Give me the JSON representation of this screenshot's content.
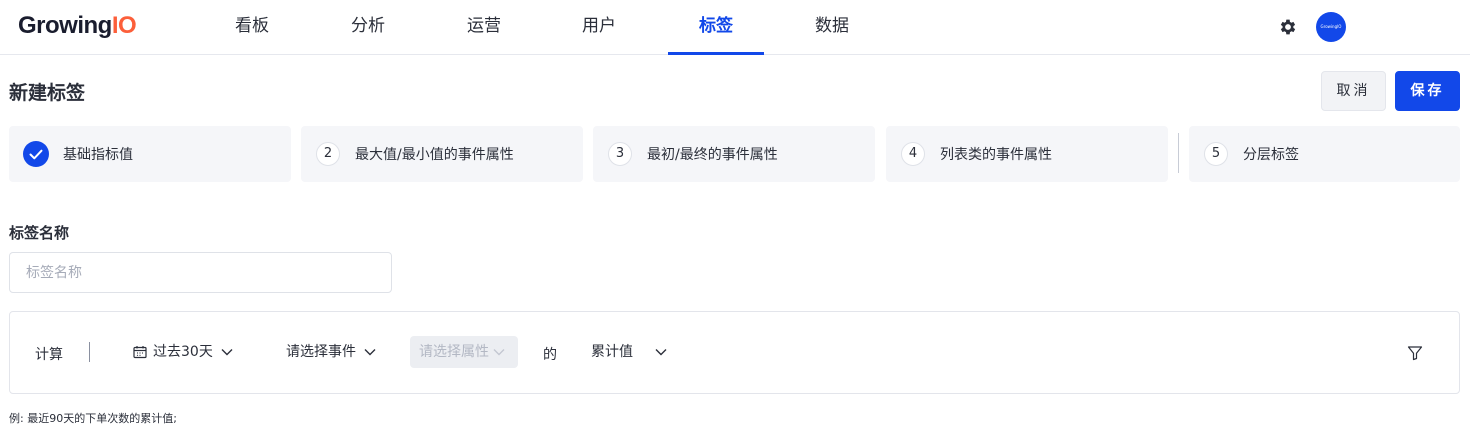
{
  "logo": {
    "main": "Growing",
    "accent": "IO"
  },
  "nav": {
    "items": [
      {
        "label": "看板"
      },
      {
        "label": "分析"
      },
      {
        "label": "运营"
      },
      {
        "label": "用户"
      },
      {
        "label": "标签"
      },
      {
        "label": "数据"
      }
    ],
    "active": "标签"
  },
  "header": {
    "avatar_text": "GrowingIO",
    "title": "新建标签",
    "cancel_label": "取消",
    "save_label": "保存"
  },
  "steps": [
    {
      "num": "1",
      "label": "基础指标值",
      "status": "done"
    },
    {
      "num": "2",
      "label": "最大值/最小值的事件属性",
      "status": "todo"
    },
    {
      "num": "3",
      "label": "最初/最终的事件属性",
      "status": "todo"
    },
    {
      "num": "4",
      "label": "列表类的事件属性",
      "status": "todo"
    },
    {
      "num": "5",
      "label": "分层标签",
      "status": "todo"
    }
  ],
  "form": {
    "name_label": "标签名称",
    "name_placeholder": "标签名称",
    "name_value": ""
  },
  "calc": {
    "label": "计算",
    "time_range": "过去30天",
    "event_select": "请选择事件",
    "property_select": "请选择属性",
    "of_text": "的",
    "metric_select": "累计值"
  },
  "example": "例: 最近90天的下单次数的累计值;",
  "colors": {
    "accent": "#1248e9",
    "logo_accent": "#fc5f3a",
    "step_bg": "#f5f6f9"
  },
  "icons": [
    "gear-icon",
    "check-icon",
    "calendar-icon",
    "chevron-down-icon",
    "filter-icon"
  ]
}
